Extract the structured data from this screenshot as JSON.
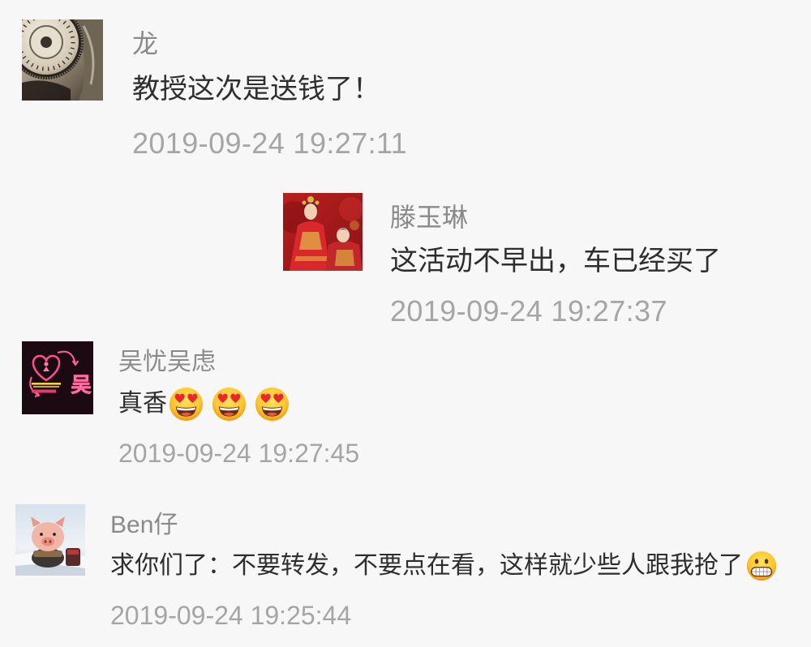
{
  "colors": {
    "background": "#f7f7f7",
    "author_name": "#8a8a8a",
    "comment_text": "#2e2e2e",
    "timestamp": "#a5a5a5"
  },
  "comments": [
    {
      "author": "龙",
      "text": "教授这次是送钱了！",
      "emojis": [],
      "time": "2019-09-24 19:27:11"
    },
    {
      "author": "滕玉琳",
      "text": "这活动不早出，车已经买了",
      "emojis": [],
      "time": "2019-09-24 19:27:37"
    },
    {
      "author": "吴忧吴虑",
      "text": "真香",
      "emojis": [
        "heart-eyes",
        "heart-eyes",
        "heart-eyes"
      ],
      "time": "2019-09-24 19:27:45",
      "avatar_logo_text": "吴"
    },
    {
      "author": "Ben仔",
      "text": "求你们了：不要转发，不要点在看，这样就少些人跟我抢了",
      "emojis": [
        "grimacing-face"
      ],
      "time": "2019-09-24 19:25:44"
    }
  ]
}
